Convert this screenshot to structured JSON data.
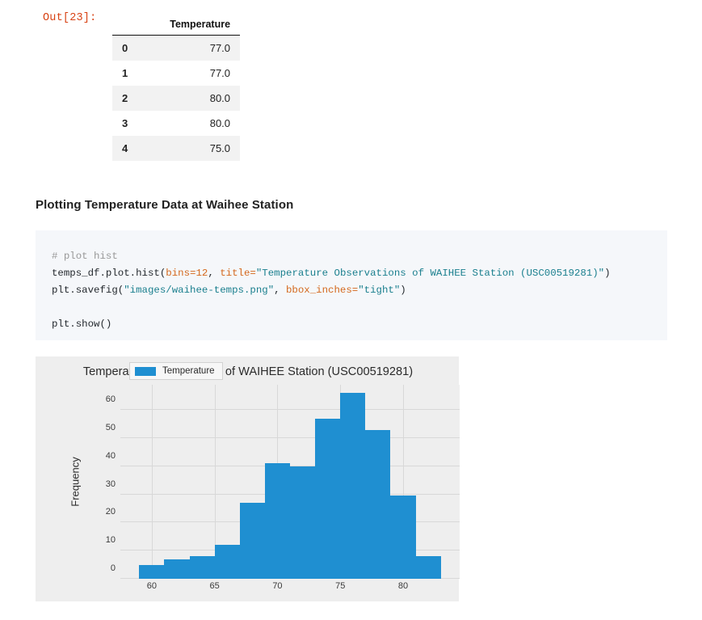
{
  "output": {
    "prompt": "Out[23]:"
  },
  "dataframe": {
    "index_header": "",
    "columns": [
      "Temperature"
    ],
    "rows": [
      {
        "index": "0",
        "Temperature": "77.0"
      },
      {
        "index": "1",
        "Temperature": "77.0"
      },
      {
        "index": "2",
        "Temperature": "80.0"
      },
      {
        "index": "3",
        "Temperature": "80.0"
      },
      {
        "index": "4",
        "Temperature": "75.0"
      }
    ]
  },
  "markdown": {
    "heading": "Plotting Temperature Data at Waihee Station"
  },
  "code_cell": {
    "line1_comment": "# plot hist",
    "line2": "temps_df.plot.hist(bins=12, title=\"Temperature Observations of WAIHEE Station (USC00519281)\")",
    "line3": "plt.savefig(\"images/waihee-temps.png\", bbox_inches=\"tight\")",
    "line5": "plt.show()",
    "tokens": {
      "t_comment": "# plot hist",
      "t_call1": "temps_df.plot.hist(",
      "t_kw_bins": "bins=12",
      "t_comma1": ", ",
      "t_kw_title": "title=",
      "t_str_title": "\"Temperature Observations of WAIHEE Station (USC00519281)\"",
      "t_close1": ")",
      "t_call2": "plt.savefig(",
      "t_str_path": "\"images/waihee-temps.png\"",
      "t_comma2": ", ",
      "t_kw_bbox": "bbox_inches=",
      "t_str_tight": "\"tight\"",
      "t_close2": ")",
      "t_show": "plt.show()"
    }
  },
  "colors": {
    "bar": "#1f8fd1",
    "figure_background": "#eeeeee",
    "code_background": "#f5f7fa",
    "prompt": "#d84315",
    "grid": "#d8d8d8"
  },
  "chart_data": {
    "type": "bar",
    "title": "Temperature Observations of WAIHEE Station (USC00519281)",
    "xlabel": "",
    "ylabel": "Frequency",
    "legend": [
      "Temperature"
    ],
    "legend_position": "upper left",
    "grid": true,
    "bins": 12,
    "bin_edges": [
      59,
      61,
      63,
      65,
      67,
      69,
      71,
      73,
      75,
      77,
      79,
      81,
      83
    ],
    "categories": [
      "59-61",
      "61-63",
      "63-65",
      "65-67",
      "67-69",
      "69-71",
      "71-73",
      "73-75",
      "75-77",
      "77-79",
      "79-81",
      "81-83"
    ],
    "values": [
      5,
      7,
      8,
      12,
      27,
      41,
      40,
      57,
      66,
      53,
      29.5,
      8
    ],
    "xlim": [
      57.5,
      84.5
    ],
    "ylim": [
      0,
      69
    ],
    "xticks": [
      60,
      65,
      70,
      75,
      80
    ],
    "yticks": [
      0,
      10,
      20,
      30,
      40,
      50,
      60
    ]
  }
}
